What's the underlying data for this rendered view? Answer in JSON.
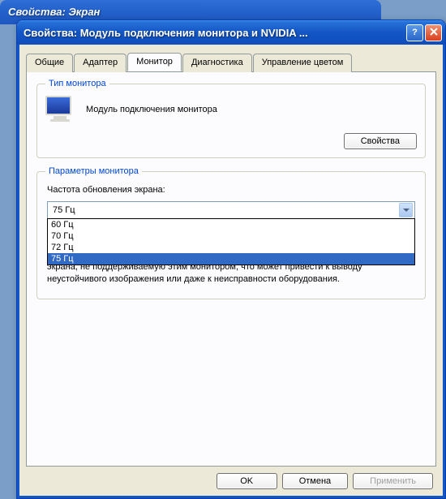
{
  "bg_window": {
    "title": "Свойства: Экран"
  },
  "titlebar": {
    "text": "Свойства: Модуль подключения монитора и NVIDIA ..."
  },
  "tabs": {
    "items": [
      {
        "label": "Общие"
      },
      {
        "label": "Адаптер"
      },
      {
        "label": "Монитор"
      },
      {
        "label": "Диагностика"
      },
      {
        "label": "Управление цветом"
      }
    ],
    "active_index": 2
  },
  "monitor_group": {
    "title": "Тип монитора",
    "name": "Модуль подключения монитора",
    "properties_btn": "Свойства"
  },
  "params_group": {
    "title": "Параметры монитора",
    "refresh_label": "Частота обновления экрана:",
    "selected": "75 Гц",
    "options": [
      "60 Гц",
      "70 Гц",
      "72 Гц",
      "75 Гц"
    ],
    "hidden_note": "экрана, не поддерживаемую этим монитором, что может привести к выводу неустойчивого изображения или даже к неисправности оборудования."
  },
  "buttons": {
    "ok": "OK",
    "cancel": "Отмена",
    "apply": "Применить"
  }
}
